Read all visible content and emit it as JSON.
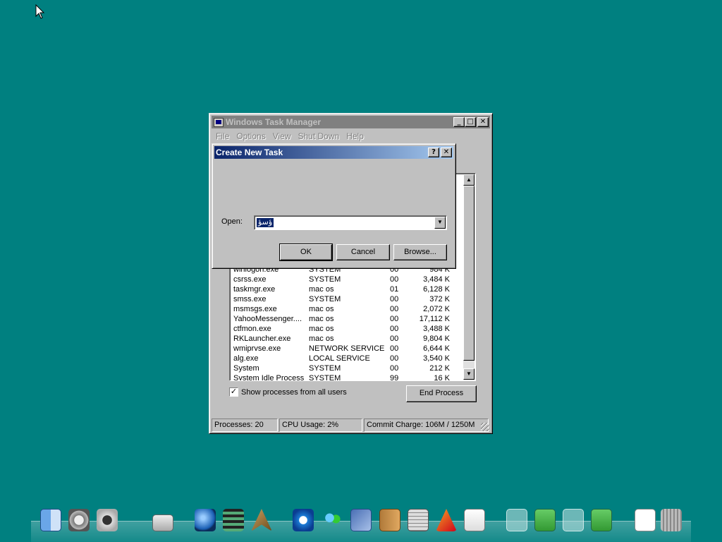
{
  "task_manager": {
    "title": "Windows Task Manager",
    "menu": [
      "File",
      "Options",
      "View",
      "Shut Down",
      "Help"
    ],
    "processes": [
      {
        "name": "winlogon.exe",
        "user": "SYSTEM",
        "cpu": "00",
        "mem": "984 K"
      },
      {
        "name": "csrss.exe",
        "user": "SYSTEM",
        "cpu": "00",
        "mem": "3,484 K"
      },
      {
        "name": "taskmgr.exe",
        "user": "mac os",
        "cpu": "01",
        "mem": "6,128 K"
      },
      {
        "name": "smss.exe",
        "user": "SYSTEM",
        "cpu": "00",
        "mem": "372 K"
      },
      {
        "name": "msmsgs.exe",
        "user": "mac os",
        "cpu": "00",
        "mem": "2,072 K"
      },
      {
        "name": "YahooMessenger....",
        "user": "mac os",
        "cpu": "00",
        "mem": "17,112 K"
      },
      {
        "name": "ctfmon.exe",
        "user": "mac os",
        "cpu": "00",
        "mem": "3,488 K"
      },
      {
        "name": "RKLauncher.exe",
        "user": "mac os",
        "cpu": "00",
        "mem": "9,804 K"
      },
      {
        "name": "wmiprvse.exe",
        "user": "NETWORK SERVICE",
        "cpu": "00",
        "mem": "6,644 K"
      },
      {
        "name": "alg.exe",
        "user": "LOCAL SERVICE",
        "cpu": "00",
        "mem": "3,540 K"
      },
      {
        "name": "System",
        "user": "SYSTEM",
        "cpu": "00",
        "mem": "212 K"
      },
      {
        "name": "System Idle Process",
        "user": "SYSTEM",
        "cpu": "99",
        "mem": "16 K"
      }
    ],
    "show_all_label": "Show processes from all users",
    "show_all_checked": true,
    "end_process_label": "End Process",
    "status": {
      "processes": "Processes: 20",
      "cpu": "CPU Usage: 2%",
      "commit": "Commit Charge: 106M / 1250M"
    }
  },
  "create_task": {
    "title": "Create New Task",
    "open_label": "Open:",
    "open_value": "ؤسؤ",
    "ok_label": "OK",
    "cancel_label": "Cancel",
    "browse_label": "Browse..."
  },
  "dock": [
    {
      "name": "finder-icon",
      "kind": "ic-finder"
    },
    {
      "name": "system-preferences-icon",
      "kind": "ic-prefs"
    },
    {
      "name": "power-icon",
      "kind": "ic-power"
    },
    {
      "name": "hard-drive-icon",
      "kind": "ic-drive"
    },
    {
      "name": "quicktime-icon",
      "kind": "ic-qt"
    },
    {
      "name": "film-strip-icon",
      "kind": "ic-film"
    },
    {
      "name": "cursor-tool-icon",
      "kind": "ic-arrow"
    },
    {
      "name": "internet-explorer-icon",
      "kind": "ic-ie"
    },
    {
      "name": "messenger-icon",
      "kind": "ic-msn"
    },
    {
      "name": "mail-icon",
      "kind": "ic-mail"
    },
    {
      "name": "address-book-icon",
      "kind": "ic-book"
    },
    {
      "name": "calculator-icon",
      "kind": "ic-calc"
    },
    {
      "name": "applications-icon",
      "kind": "ic-appdir"
    },
    {
      "name": "text-editor-icon",
      "kind": "ic-text"
    },
    {
      "name": "stack-icon",
      "kind": "ic-box"
    },
    {
      "name": "windows-box-icon",
      "kind": "ic-dl"
    },
    {
      "name": "stack-icon",
      "kind": "ic-box"
    },
    {
      "name": "downloads-icon",
      "kind": "ic-dl"
    },
    {
      "name": "document-icon",
      "kind": "ic-doc"
    },
    {
      "name": "trash-icon",
      "kind": "ic-trash"
    }
  ]
}
